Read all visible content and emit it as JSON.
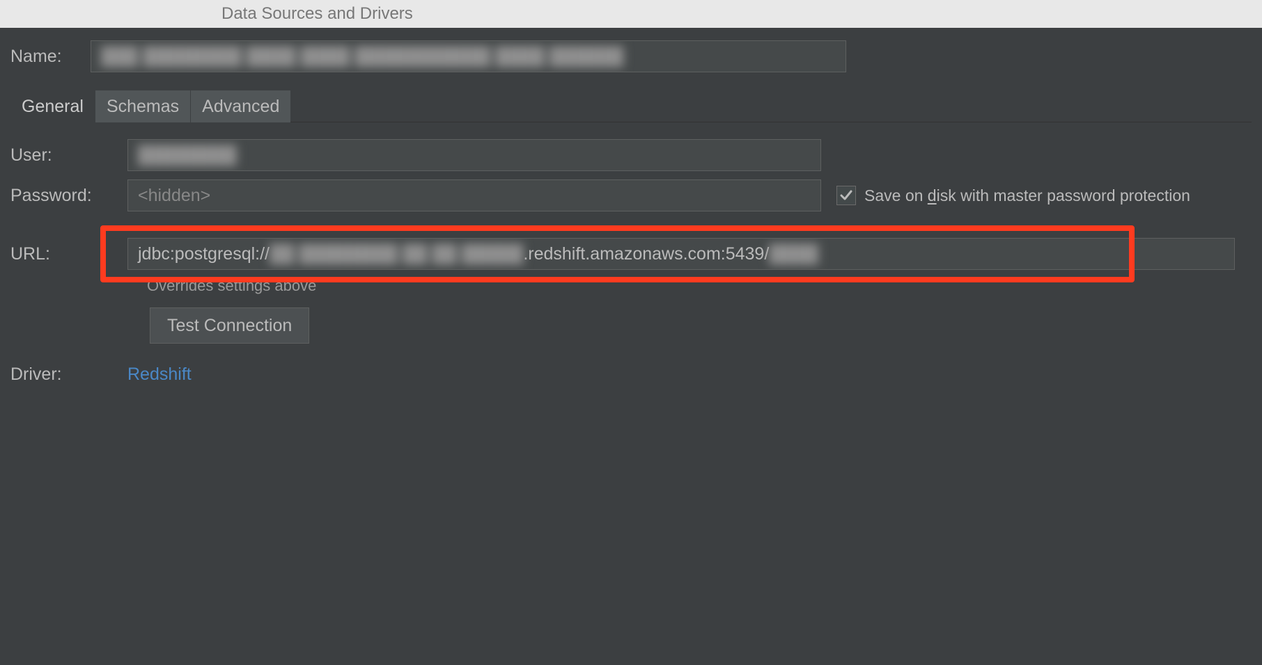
{
  "titlebar": {
    "title": "Data Sources and Drivers"
  },
  "form": {
    "name_label": "Name:",
    "name_value": "███ ████████ ████ ████ ███████████ ████ ██████",
    "user_label": "User:",
    "user_value": "████████",
    "password_label": "Password:",
    "password_value": "<hidden>",
    "save_text_a": "Save on ",
    "save_text_d": "d",
    "save_text_b": "isk with master password protection",
    "save_checked": true,
    "url_label": "URL:",
    "url_prefix": "jdbc:postgresql://",
    "url_blur1": "██ ████████ ██ ██ █████",
    "url_mid": ".redshift.amazonaws.com:5439/",
    "url_blur2": "████",
    "url_hint": "Overrides settings above",
    "test_connection_label": "Test Connection",
    "driver_label": "Driver:",
    "driver_link_text": "Redshift"
  },
  "tabs": [
    {
      "label": "General",
      "active": true
    },
    {
      "label": "Schemas",
      "active": false
    },
    {
      "label": "Advanced",
      "active": false
    }
  ]
}
